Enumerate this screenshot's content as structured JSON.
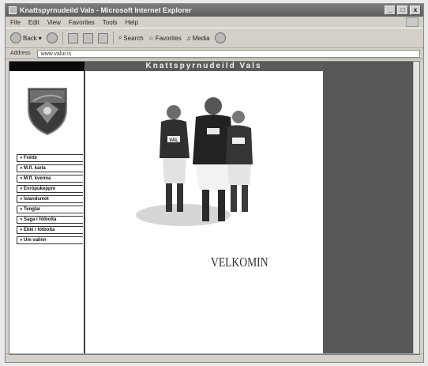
{
  "window": {
    "title": "Knattspyrnudeild Vals - Microsoft Internet Explorer",
    "minimize": "_",
    "maximize": "□",
    "close": "x"
  },
  "menubar": {
    "items": [
      "File",
      "Edit",
      "View",
      "Favorites",
      "Tools",
      "Help"
    ]
  },
  "toolbar": {
    "back_label": "Back",
    "search_label": "Search",
    "favorites_label": "Favorites",
    "media_label": "Media"
  },
  "address": {
    "label": "Address",
    "url": "www.valur.is"
  },
  "page": {
    "header": "Knattspyrnudeild Vals",
    "welcome": "VELKOMIN",
    "nav": [
      "Fréttir",
      "M.fl. karla",
      "M.fl. kvenna",
      "Evrópukeppni",
      "Íslandsmót",
      "Tenglar",
      "Saga í fótbolta",
      "Ekki í fótbolta",
      "Um valinn"
    ],
    "jersey_text": "VAL"
  },
  "colors": {
    "header_bg": "#5b5b5b",
    "right_panel": "#585858",
    "left_top": "#0a0a0a"
  }
}
